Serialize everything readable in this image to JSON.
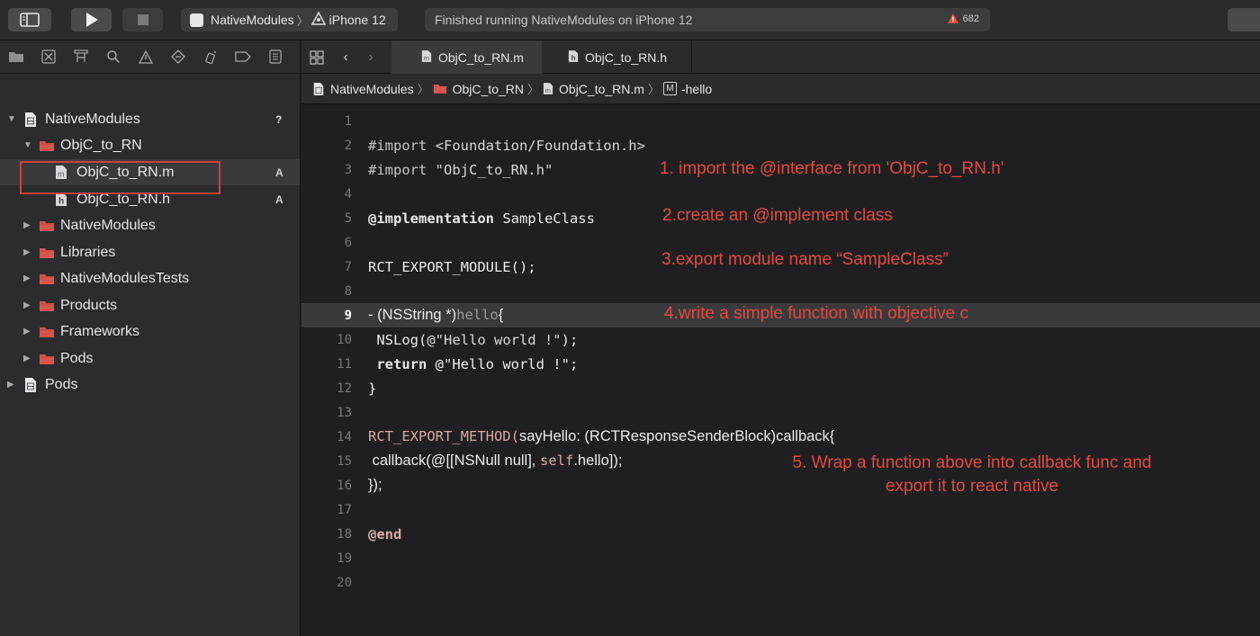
{
  "toolbar": {
    "scheme_name": "NativeModules",
    "device_name": "iPhone 12",
    "activity_text": "Finished running NativeModules on iPhone 12",
    "warning_count": "682"
  },
  "navigator": {
    "tree": [
      {
        "label": "NativeModules",
        "badge": "?",
        "kind": "project"
      },
      {
        "label": "ObjC_to_RN",
        "badge": "",
        "kind": "folder"
      },
      {
        "label": "ObjC_to_RN.m",
        "badge": "A",
        "kind": "m-file"
      },
      {
        "label": "ObjC_to_RN.h",
        "badge": "A",
        "kind": "h-file"
      },
      {
        "label": "NativeModules",
        "badge": "",
        "kind": "folder"
      },
      {
        "label": "Libraries",
        "badge": "",
        "kind": "folder"
      },
      {
        "label": "NativeModulesTests",
        "badge": "",
        "kind": "folder"
      },
      {
        "label": "Products",
        "badge": "",
        "kind": "folder"
      },
      {
        "label": "Frameworks",
        "badge": "",
        "kind": "folder"
      },
      {
        "label": "Pods",
        "badge": "",
        "kind": "folder"
      },
      {
        "label": "Pods",
        "badge": "",
        "kind": "project"
      }
    ]
  },
  "editor": {
    "tabs": [
      {
        "label": "ObjC_to_RN.m",
        "active": true
      },
      {
        "label": "ObjC_to_RN.h",
        "active": false
      }
    ],
    "breadcrumb": [
      "NativeModules",
      "ObjC_to_RN",
      "ObjC_to_RN.m",
      "-hello"
    ],
    "breadcrumb_m": "M",
    "line_numbers": [
      "1",
      "2",
      "3",
      "4",
      "5",
      "6",
      "7",
      "8",
      "9",
      "10",
      "11",
      "12",
      "13",
      "14",
      "15",
      "16",
      "17",
      "18",
      "19",
      "20"
    ],
    "code": {
      "l2_kw": "#import",
      "l2_str": " <Foundation/Foundation.h>",
      "l3_kw": "#import",
      "l3_str": " \"ObjC_to_RN.h\"",
      "l5_kw": "@implementation",
      "l5_rest": " SampleClass",
      "l7": "RCT_EXPORT_MODULE();",
      "l9_a": "- (NSString *)",
      "l9_b": "hello",
      "l9_c": "{",
      "l10_a": " NSLog(",
      "l10_b": "@\"Hello world !\"",
      "l10_c": ");",
      "l11_kw": " return",
      "l11_rest": " @\"Hello world !\";",
      "l12": "}",
      "l14_a": "RCT_EXPORT_METHOD(",
      "l14_b": "sayHello: (RCTResponseSenderBlock)callback{",
      "l15_a": " callback(@[[NSNull null], ",
      "l15_self": "self",
      "l15_b": ".hello]);",
      "l16": "});",
      "l18": "@end"
    },
    "annotations": {
      "a1": "1. import the @interface from 'ObjC_to_RN.h'",
      "a2": "2.create an @implement class",
      "a3": "3.export module name “SampleClass”",
      "a4": "4.write a simple function with objective c",
      "a5_line1": "5. Wrap a function above into callback func and",
      "a5_line2": "export it to react native"
    }
  },
  "colors": {
    "annotation": "#e5483f",
    "selection_outline": "#d0413b",
    "folder": "#d6574e"
  }
}
